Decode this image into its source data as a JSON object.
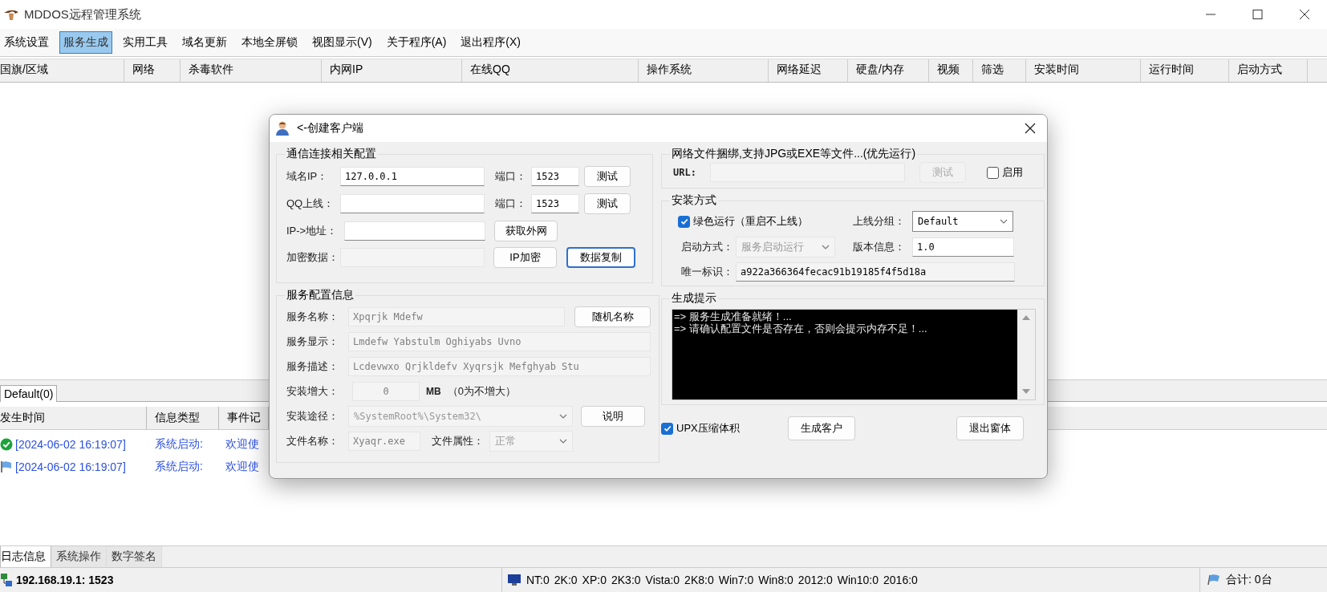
{
  "window": {
    "title": "MDDOS远程管理系统"
  },
  "menu": [
    {
      "label": "系统设置",
      "selected": false
    },
    {
      "label": "服务生成",
      "selected": true
    },
    {
      "label": "实用工具",
      "selected": false
    },
    {
      "label": "域名更新",
      "selected": false
    },
    {
      "label": "本地全屏锁",
      "selected": false
    },
    {
      "label": "视图显示(V)",
      "selected": false
    },
    {
      "label": "关于程序(A)",
      "selected": false
    },
    {
      "label": "退出程序(X)",
      "selected": false
    }
  ],
  "host_table": {
    "columns": [
      "国旗/区域",
      "网络",
      "杀毒软件",
      "内网IP",
      "在线QQ",
      "操作系统",
      "网络延迟",
      "硬盘/内存",
      "视频",
      "筛选",
      "安装时间",
      "运行时间",
      "启动方式"
    ]
  },
  "group_tabs": [
    {
      "label": "Default(0)",
      "selected": true
    }
  ],
  "log_table": {
    "columns": [
      "发生时间",
      "信息类型",
      "事件记"
    ],
    "rows": [
      {
        "kind": "success",
        "time": "[2024-06-02 16:19:07]",
        "type": "系统启动:",
        "event": "欢迎使"
      },
      {
        "kind": "flag",
        "time": "[2024-06-02 16:19:07]",
        "type": "系统启动:",
        "event": "欢迎使"
      }
    ]
  },
  "bottom_tabs": [
    {
      "label": "日志信息",
      "selected": true
    },
    {
      "label": "系统操作",
      "selected": false
    },
    {
      "label": "数字签名",
      "selected": false
    }
  ],
  "status_bar": {
    "address": "192.168.19.1: 1523",
    "os_counts": [
      "NT:0",
      "2K:0",
      "XP:0",
      "2K3:0",
      "Vista:0",
      "2K8:0",
      "Win7:0",
      "Win8:0",
      "2012:0",
      "Win10:0",
      "2016:0"
    ],
    "total": "合计: 0台"
  },
  "dialog": {
    "title": "<-创建客户端",
    "connection": {
      "title": "通信连接相关配置",
      "rows": [
        {
          "label": "域名IP：",
          "field": {
            "value": "127.0.0.1",
            "disabled": false
          },
          "port_label": "端口：",
          "port": "1523",
          "buttons": [
            {
              "label": "测试",
              "focused": false
            }
          ]
        },
        {
          "label": "QQ上线：",
          "field": {
            "disabled": false
          },
          "port_label": "端口：",
          "port": "1523",
          "buttons": [
            {
              "label": "测试",
              "focused": false
            }
          ]
        },
        {
          "label": "IP->地址：",
          "field": {
            "disabled": false
          },
          "buttons": [
            {
              "label": "获取外网",
              "focused": false
            }
          ]
        },
        {
          "label": "加密数据：",
          "field": {
            "disabled": true
          },
          "buttons": [
            {
              "label": "IP加密",
              "focused": false
            },
            {
              "label": "数据复制",
              "focused": true
            }
          ]
        }
      ]
    },
    "service": {
      "title": "服务配置信息",
      "rows": [
        {
          "kind": "field",
          "label": "服务名称：",
          "value": "Xpqrjk Mdefw",
          "disabled": true,
          "button": "随机名称"
        },
        {
          "kind": "field",
          "label": "服务显示：",
          "value": "Lmdefw Yabstulm Oghiyabs Uvno",
          "disabled": true
        },
        {
          "kind": "field",
          "label": "服务描述：",
          "value": "Lcdevwxo Qrjkldefv Xyqrsjk Mefghyab Stu",
          "disabled": true
        },
        {
          "kind": "size",
          "label": "安装增大：",
          "value": "0",
          "disabled": true,
          "unit": "MB",
          "note": "（0为不增大）"
        },
        {
          "kind": "select",
          "label": "安装途径：",
          "value": "%SystemRoot%\\System32\\",
          "disabled": true,
          "button": "说明"
        },
        {
          "kind": "file",
          "label": "文件名称：",
          "value": "Xyaqr.exe",
          "disabled": true,
          "attr_label": "文件属性：",
          "attr_value": "正常"
        }
      ]
    },
    "bind": {
      "title": "网络文件捆绑,支持JPG或EXE等文件...(优先运行)",
      "url_label": "URL:",
      "url_disabled": true,
      "test_button": {
        "label": "测试",
        "disabled": true
      },
      "enable": {
        "label": "启用",
        "checked": false
      }
    },
    "install": {
      "title": "安装方式",
      "green_run": {
        "label": "绿色运行（重启不上线）",
        "checked": true
      },
      "group_label": "上线分组：",
      "group_value": "Default",
      "start_label": "启动方式：",
      "start_value": "服务启动运行",
      "start_disabled": true,
      "version_label": "版本信息：",
      "version": "1.0",
      "id_label": "唯一标识：",
      "id": "a922a366364fecac91b19185f4f5d18a"
    },
    "console": {
      "title": "生成提示",
      "lines": [
        "=> 服务生成准备就绪！...",
        "=> 请确认配置文件是否存在，否则会提示内存不足！..."
      ]
    },
    "upx": {
      "label": "UPX压缩体积",
      "checked": true
    },
    "buttons": [
      {
        "label": "生成客户"
      },
      {
        "label": "退出窗体"
      }
    ]
  }
}
